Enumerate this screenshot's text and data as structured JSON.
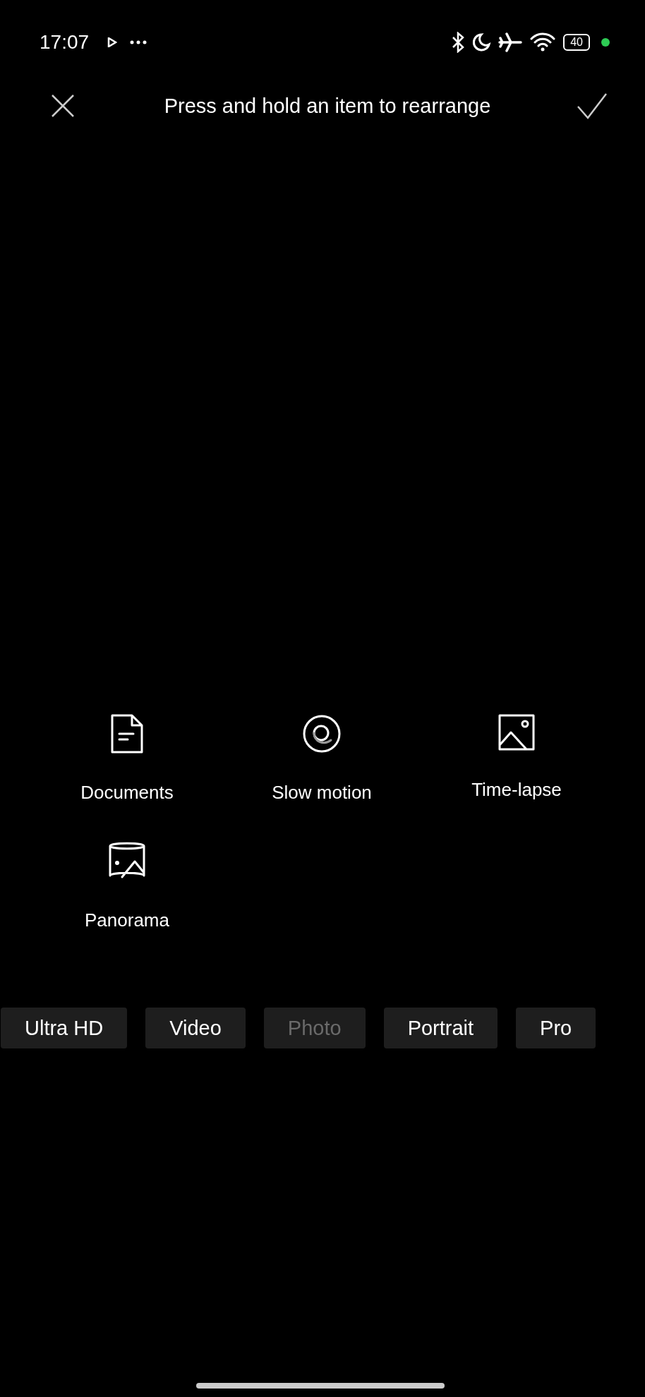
{
  "status_bar": {
    "time": "17:07",
    "battery": "40"
  },
  "header": {
    "title": "Press and hold an item to rearrange"
  },
  "modes": [
    {
      "label": "Documents"
    },
    {
      "label": "Slow motion"
    },
    {
      "label": "Time-lapse"
    },
    {
      "label": "Panorama"
    }
  ],
  "mode_bar": [
    {
      "label": "Ultra HD",
      "disabled": false
    },
    {
      "label": "Video",
      "disabled": false
    },
    {
      "label": "Photo",
      "disabled": true
    },
    {
      "label": "Portrait",
      "disabled": false
    },
    {
      "label": "Pro",
      "disabled": false
    }
  ]
}
